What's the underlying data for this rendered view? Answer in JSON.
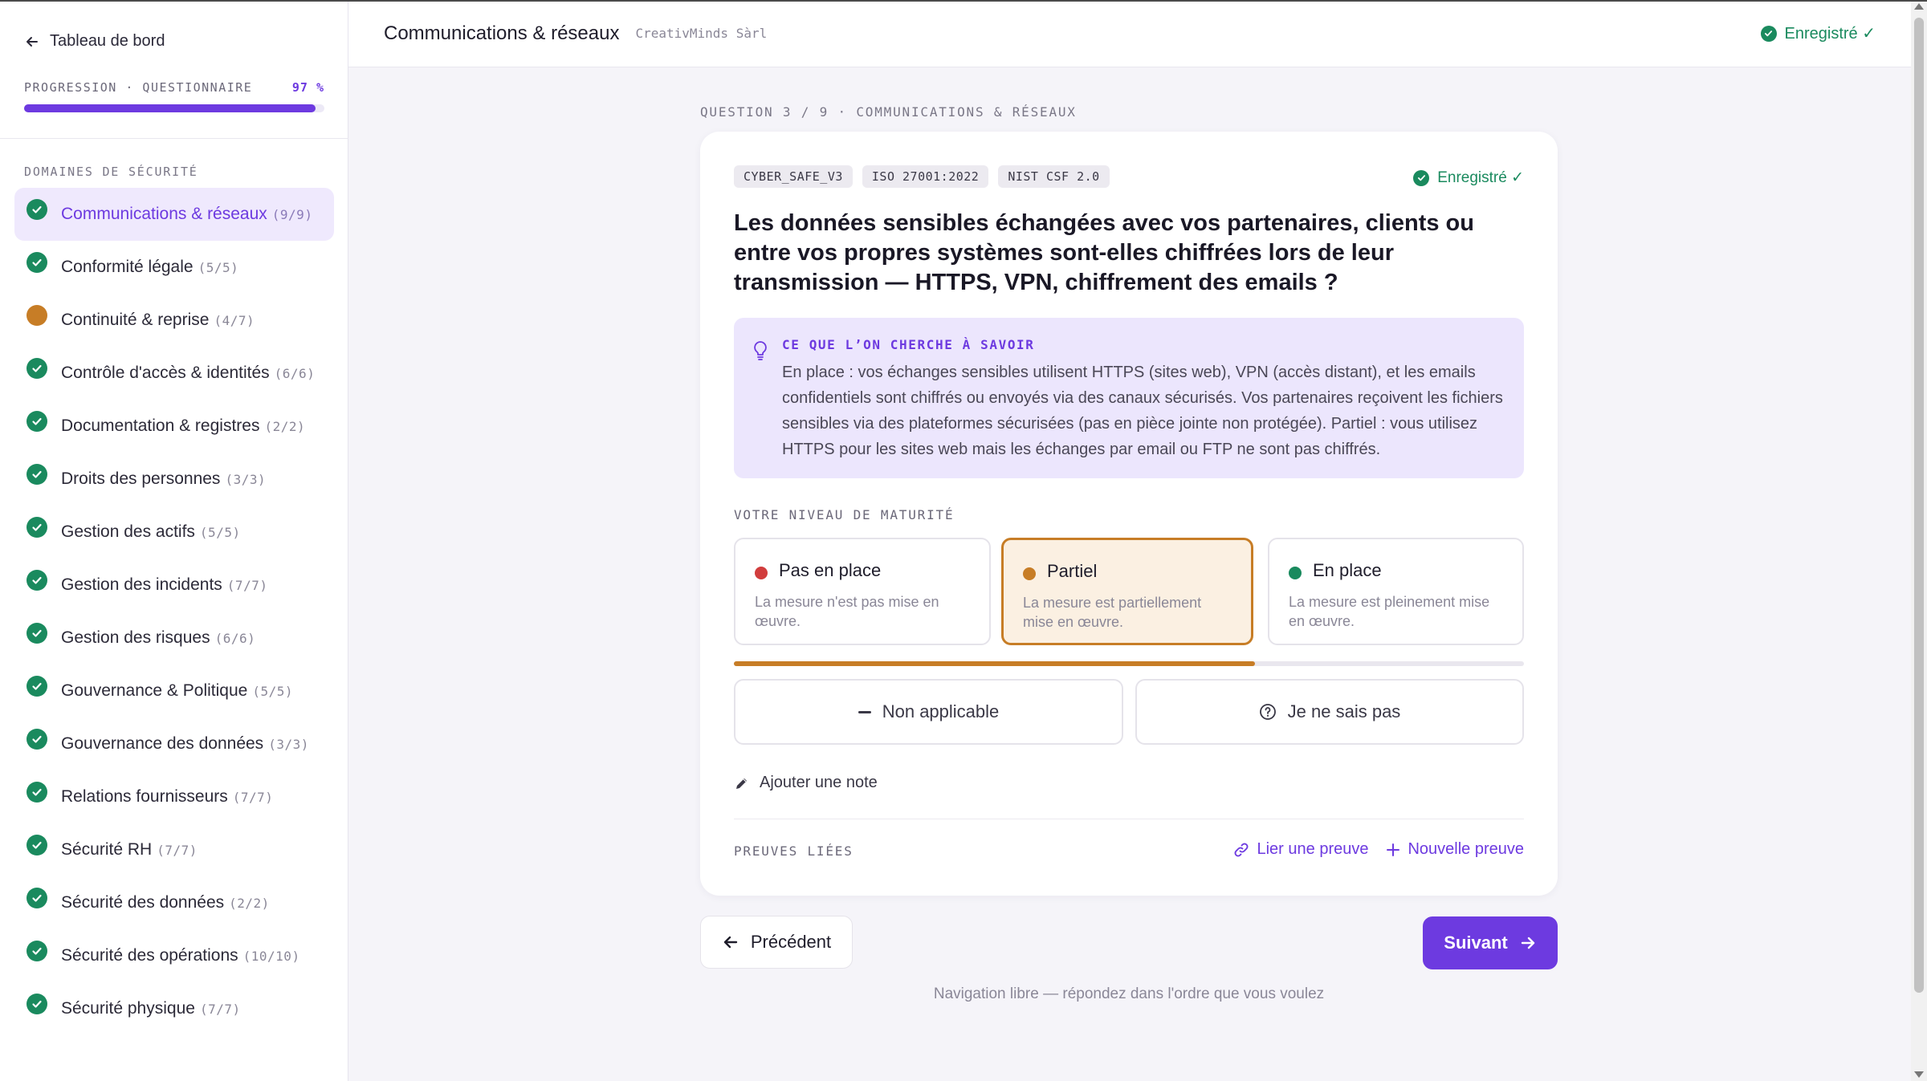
{
  "sidebar": {
    "back_label": "Tableau de bord",
    "progress_label": "PROGRESSION · QUESTIONNAIRE",
    "progress_pct_label": "97 %",
    "progress_value": 0.97,
    "section_title": "DOMAINES DE SÉCURITÉ",
    "domains": [
      {
        "label": "Communications & réseaux",
        "count": "(9/9)",
        "status": "complete",
        "active": true
      },
      {
        "label": "Conformité légale",
        "count": "(5/5)",
        "status": "complete"
      },
      {
        "label": "Continuité & reprise",
        "count": "(4/7)",
        "status": "partial"
      },
      {
        "label": "Contrôle d'accès & identités",
        "count": "(6/6)",
        "status": "complete"
      },
      {
        "label": "Documentation & registres",
        "count": "(2/2)",
        "status": "complete"
      },
      {
        "label": "Droits des personnes",
        "count": "(3/3)",
        "status": "complete"
      },
      {
        "label": "Gestion des actifs",
        "count": "(5/5)",
        "status": "complete"
      },
      {
        "label": "Gestion des incidents",
        "count": "(7/7)",
        "status": "complete"
      },
      {
        "label": "Gestion des risques",
        "count": "(6/6)",
        "status": "complete"
      },
      {
        "label": "Gouvernance & Politique",
        "count": "(5/5)",
        "status": "complete"
      },
      {
        "label": "Gouvernance des données",
        "count": "(3/3)",
        "status": "complete"
      },
      {
        "label": "Relations fournisseurs",
        "count": "(7/7)",
        "status": "complete"
      },
      {
        "label": "Sécurité RH",
        "count": "(7/7)",
        "status": "complete"
      },
      {
        "label": "Sécurité des données",
        "count": "(2/2)",
        "status": "complete"
      },
      {
        "label": "Sécurité des opérations",
        "count": "(10/10)",
        "status": "complete"
      },
      {
        "label": "Sécurité physique",
        "count": "(7/7)",
        "status": "complete"
      }
    ]
  },
  "header": {
    "title": "Communications & réseaux",
    "org": "CreativMinds Sàrl",
    "saved_label": "Enregistré ✓"
  },
  "main": {
    "breadcrumb": "QUESTION 3 / 9 · COMMUNICATIONS & RÉSEAUX",
    "tags": [
      "CYBER_SAFE_V3",
      "ISO 27001:2022",
      "NIST CSF 2.0"
    ],
    "saved_label": "Enregistré ✓",
    "question": "Les données sensibles échangées avec vos partenaires, clients ou entre vos propres systèmes sont-elles chiffrées lors de leur transmission — HTTPS, VPN, chiffrement des emails ?",
    "hint_title": "CE QUE L’ON CHERCHE À SAVOIR",
    "hint_body": "En place : vos échanges sensibles utilisent HTTPS (sites web), VPN (accès distant), et les emails confidentiels sont chiffrés ou envoyés via des canaux sécurisés. Vos partenaires reçoivent les fichiers sensibles via des plateformes sécurisées (pas en pièce jointe non protégée). Partiel : vous utilisez HTTPS pour les sites web mais les échanges par email ou FTP ne sont pas chiffrés.",
    "maturity_label": "VOTRE NIVEAU DE MATURITÉ",
    "options": [
      {
        "title": "Pas en place",
        "desc": "La mesure n'est pas mise en œuvre.",
        "color": "#d13d3d"
      },
      {
        "title": "Partiel",
        "desc": "La mesure est partiellement mise en œuvre.",
        "color": "#c77d26",
        "selected": true
      },
      {
        "title": "En place",
        "desc": "La mesure est pleinement mise en œuvre.",
        "color": "#1a8a5e"
      }
    ],
    "maturity_level": 0.66,
    "na_label": "Non applicable",
    "idk_label": "Je ne sais pas",
    "add_note_label": "Ajouter une note",
    "proofs_label": "PREUVES LIÉES",
    "link_proof_label": "Lier une preuve",
    "new_proof_label": "Nouvelle preuve"
  },
  "nav": {
    "prev_label": "Précédent",
    "next_label": "Suivant",
    "footnote": "Navigation libre — répondez dans l'ordre que vous voulez"
  },
  "colors": {
    "accent": "#6d3ae0",
    "success": "#1a8a5e",
    "partial": "#c77d26",
    "danger": "#d13d3d"
  }
}
